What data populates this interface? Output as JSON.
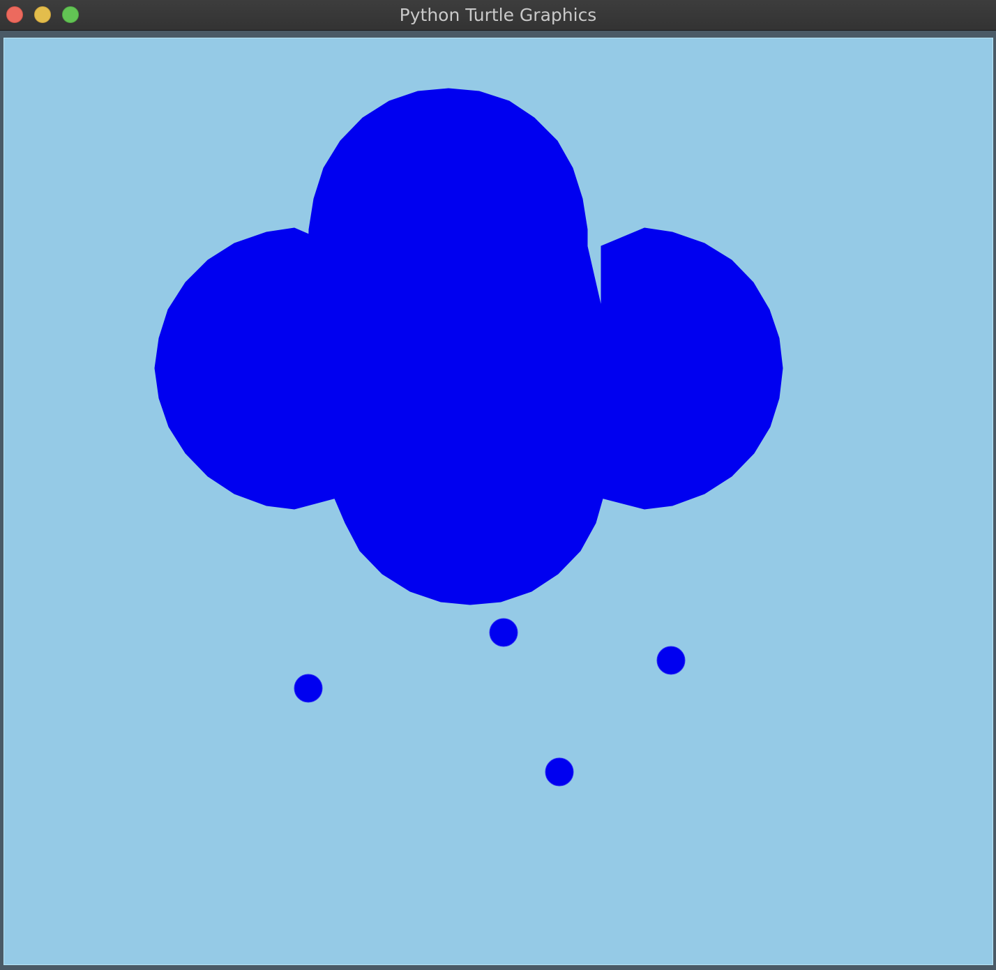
{
  "window": {
    "title": "Python Turtle Graphics"
  },
  "colors": {
    "canvas_background": "#95cae6",
    "fill": "#0000f0",
    "outline": "#2a2af5",
    "close_button": "#ec6a5e",
    "minimize_button": "#e3bd4c",
    "zoom_button": "#62c454"
  }
}
